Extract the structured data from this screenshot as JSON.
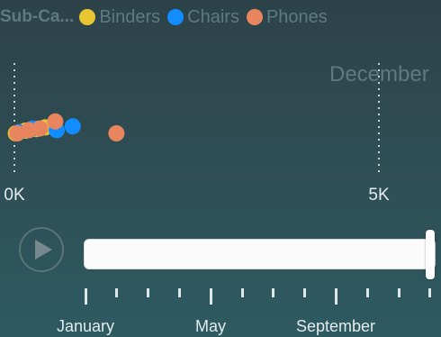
{
  "legend": {
    "title": "Sub-Ca...",
    "items": [
      {
        "label": "Binders",
        "color": "#e8c631"
      },
      {
        "label": "Chairs",
        "color": "#118dff"
      },
      {
        "label": "Phones",
        "color": "#e8855f"
      }
    ]
  },
  "chart_data": {
    "type": "scatter",
    "period_label": "December",
    "x_ticks": [
      "0K",
      "5K"
    ],
    "xlim": [
      0,
      5000
    ],
    "series": [
      {
        "name": "Binders",
        "color": "#e8c631",
        "points": [
          {
            "x": 20,
            "y": 0
          },
          {
            "x": 150,
            "y": 0.5
          },
          {
            "x": 300,
            "y": 0.8
          },
          {
            "x": 420,
            "y": 1.1
          }
        ]
      },
      {
        "name": "Chairs",
        "color": "#118dff",
        "points": [
          {
            "x": 60,
            "y": 0.2
          },
          {
            "x": 250,
            "y": 0.9
          },
          {
            "x": 580,
            "y": 0.6
          },
          {
            "x": 800,
            "y": 1.3
          }
        ]
      },
      {
        "name": "Phones",
        "color": "#e8855f",
        "points": [
          {
            "x": 40,
            "y": 0
          },
          {
            "x": 200,
            "y": 0.6
          },
          {
            "x": 350,
            "y": 0.9
          },
          {
            "x": 560,
            "y": 2.2
          },
          {
            "x": 1400,
            "y": 0
          }
        ]
      }
    ]
  },
  "timeline": {
    "months": [
      "January",
      "May",
      "September"
    ],
    "position": 1.0
  }
}
